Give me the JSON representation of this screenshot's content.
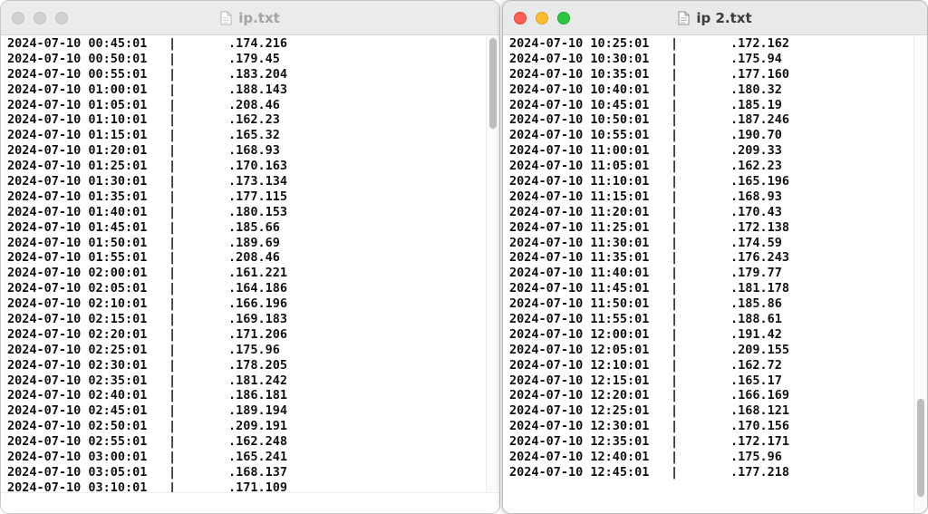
{
  "windows": {
    "left": {
      "title": "ip.txt",
      "lines": [
        {
          "ts": "2024-07-10 00:45:01",
          "sep": "|",
          "ip": ".174.216"
        },
        {
          "ts": "2024-07-10 00:50:01",
          "sep": "|",
          "ip": ".179.45"
        },
        {
          "ts": "2024-07-10 00:55:01",
          "sep": "|",
          "ip": ".183.204"
        },
        {
          "ts": "2024-07-10 01:00:01",
          "sep": "|",
          "ip": ".188.143"
        },
        {
          "ts": "2024-07-10 01:05:01",
          "sep": "|",
          "ip": ".208.46"
        },
        {
          "ts": "2024-07-10 01:10:01",
          "sep": "|",
          "ip": ".162.23"
        },
        {
          "ts": "2024-07-10 01:15:01",
          "sep": "|",
          "ip": ".165.32"
        },
        {
          "ts": "2024-07-10 01:20:01",
          "sep": "|",
          "ip": ".168.93"
        },
        {
          "ts": "2024-07-10 01:25:01",
          "sep": "|",
          "ip": ".170.163"
        },
        {
          "ts": "2024-07-10 01:30:01",
          "sep": "|",
          "ip": ".173.134"
        },
        {
          "ts": "2024-07-10 01:35:01",
          "sep": "|",
          "ip": ".177.115"
        },
        {
          "ts": "2024-07-10 01:40:01",
          "sep": "|",
          "ip": ".180.153"
        },
        {
          "ts": "2024-07-10 01:45:01",
          "sep": "|",
          "ip": ".185.66"
        },
        {
          "ts": "2024-07-10 01:50:01",
          "sep": "|",
          "ip": ".189.69"
        },
        {
          "ts": "2024-07-10 01:55:01",
          "sep": "|",
          "ip": ".208.46"
        },
        {
          "ts": "2024-07-10 02:00:01",
          "sep": "|",
          "ip": ".161.221"
        },
        {
          "ts": "2024-07-10 02:05:01",
          "sep": "|",
          "ip": ".164.186"
        },
        {
          "ts": "2024-07-10 02:10:01",
          "sep": "|",
          "ip": ".166.196"
        },
        {
          "ts": "2024-07-10 02:15:01",
          "sep": "|",
          "ip": ".169.183"
        },
        {
          "ts": "2024-07-10 02:20:01",
          "sep": "|",
          "ip": ".171.206"
        },
        {
          "ts": "2024-07-10 02:25:01",
          "sep": "|",
          "ip": ".175.96"
        },
        {
          "ts": "2024-07-10 02:30:01",
          "sep": "|",
          "ip": ".178.205"
        },
        {
          "ts": "2024-07-10 02:35:01",
          "sep": "|",
          "ip": ".181.242"
        },
        {
          "ts": "2024-07-10 02:40:01",
          "sep": "|",
          "ip": ".186.181"
        },
        {
          "ts": "2024-07-10 02:45:01",
          "sep": "|",
          "ip": ".189.194"
        },
        {
          "ts": "2024-07-10 02:50:01",
          "sep": "|",
          "ip": ".209.191"
        },
        {
          "ts": "2024-07-10 02:55:01",
          "sep": "|",
          "ip": ".162.248"
        },
        {
          "ts": "2024-07-10 03:00:01",
          "sep": "|",
          "ip": ".165.241"
        },
        {
          "ts": "2024-07-10 03:05:01",
          "sep": "|",
          "ip": ".168.137"
        },
        {
          "ts": "2024-07-10 03:10:01",
          "sep": "|",
          "ip": ".171.109"
        }
      ]
    },
    "right": {
      "title": "ip 2.txt",
      "lines": [
        {
          "ts": "2024-07-10 10:25:01",
          "sep": "|",
          "ip": ".172.162"
        },
        {
          "ts": "2024-07-10 10:30:01",
          "sep": "|",
          "ip": ".175.94"
        },
        {
          "ts": "2024-07-10 10:35:01",
          "sep": "|",
          "ip": ".177.160"
        },
        {
          "ts": "2024-07-10 10:40:01",
          "sep": "|",
          "ip": ".180.32"
        },
        {
          "ts": "2024-07-10 10:45:01",
          "sep": "|",
          "ip": ".185.19"
        },
        {
          "ts": "2024-07-10 10:50:01",
          "sep": "|",
          "ip": ".187.246"
        },
        {
          "ts": "2024-07-10 10:55:01",
          "sep": "|",
          "ip": ".190.70"
        },
        {
          "ts": "2024-07-10 11:00:01",
          "sep": "|",
          "ip": ".209.33"
        },
        {
          "ts": "2024-07-10 11:05:01",
          "sep": "|",
          "ip": ".162.23"
        },
        {
          "ts": "2024-07-10 11:10:01",
          "sep": "|",
          "ip": ".165.196"
        },
        {
          "ts": "2024-07-10 11:15:01",
          "sep": "|",
          "ip": ".168.93"
        },
        {
          "ts": "2024-07-10 11:20:01",
          "sep": "|",
          "ip": ".170.43"
        },
        {
          "ts": "2024-07-10 11:25:01",
          "sep": "|",
          "ip": ".172.138"
        },
        {
          "ts": "2024-07-10 11:30:01",
          "sep": "|",
          "ip": ".174.59"
        },
        {
          "ts": "2024-07-10 11:35:01",
          "sep": "|",
          "ip": ".176.243"
        },
        {
          "ts": "2024-07-10 11:40:01",
          "sep": "|",
          "ip": ".179.77"
        },
        {
          "ts": "2024-07-10 11:45:01",
          "sep": "|",
          "ip": ".181.178"
        },
        {
          "ts": "2024-07-10 11:50:01",
          "sep": "|",
          "ip": ".185.86"
        },
        {
          "ts": "2024-07-10 11:55:01",
          "sep": "|",
          "ip": ".188.61"
        },
        {
          "ts": "2024-07-10 12:00:01",
          "sep": "|",
          "ip": ".191.42"
        },
        {
          "ts": "2024-07-10 12:05:01",
          "sep": "|",
          "ip": ".209.155"
        },
        {
          "ts": "2024-07-10 12:10:01",
          "sep": "|",
          "ip": ".162.72"
        },
        {
          "ts": "2024-07-10 12:15:01",
          "sep": "|",
          "ip": ".165.17"
        },
        {
          "ts": "2024-07-10 12:20:01",
          "sep": "|",
          "ip": ".166.169"
        },
        {
          "ts": "2024-07-10 12:25:01",
          "sep": "|",
          "ip": ".168.121"
        },
        {
          "ts": "2024-07-10 12:30:01",
          "sep": "|",
          "ip": ".170.156"
        },
        {
          "ts": "2024-07-10 12:35:01",
          "sep": "|",
          "ip": ".172.171"
        },
        {
          "ts": "2024-07-10 12:40:01",
          "sep": "|",
          "ip": ".175.96"
        },
        {
          "ts": "2024-07-10 12:45:01",
          "sep": "|",
          "ip": ".177.218"
        }
      ]
    }
  },
  "colors": {
    "close": "#ff5f57",
    "minimize": "#febc2e",
    "zoom": "#28c840",
    "inactive_light": "#d0d0d0"
  },
  "icons": {
    "document": "document-icon"
  }
}
